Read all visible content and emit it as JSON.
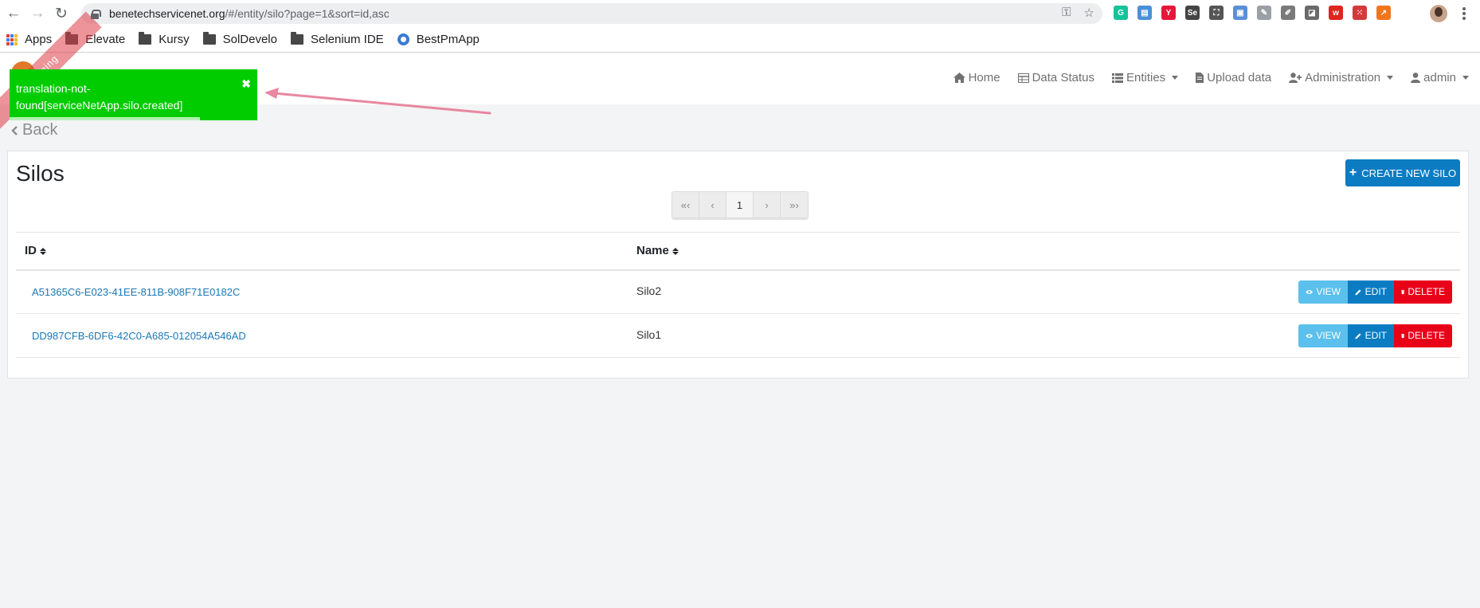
{
  "browser": {
    "url_host": "benetechservicenet.org",
    "url_path": "/#/entity/silo?page=1&sort=id,asc",
    "nav_back": "←",
    "nav_forward": "→",
    "nav_reload": "↻",
    "key_icon": "⚿",
    "star_icon": "☆",
    "bookmarks": [
      {
        "label": "Apps",
        "icon": "apps-grid-icon"
      },
      {
        "label": "Elevate",
        "icon": "folder-icon"
      },
      {
        "label": "Kursy",
        "icon": "folder-icon"
      },
      {
        "label": "SolDevelo",
        "icon": "folder-icon"
      },
      {
        "label": "Selenium IDE",
        "icon": "folder-icon"
      },
      {
        "label": "BestPmApp",
        "icon": "bestpmapp-icon"
      }
    ],
    "extensions": [
      {
        "color": "#15c39a",
        "glyph": "G"
      },
      {
        "color": "#4a90d9",
        "glyph": "▤"
      },
      {
        "color": "#e8173a",
        "glyph": "Y"
      },
      {
        "color": "#444444",
        "glyph": "Se"
      },
      {
        "color": "#555555",
        "glyph": "⛶"
      },
      {
        "color": "#5a8fd6",
        "glyph": "▣"
      },
      {
        "color": "#9aa0a6",
        "glyph": "✎"
      },
      {
        "color": "#7a7a7a",
        "glyph": "✐"
      },
      {
        "color": "#6a6a6a",
        "glyph": "◪"
      },
      {
        "color": "#e0241f",
        "glyph": "w"
      },
      {
        "color": "#d23b3b",
        "glyph": "⁙"
      },
      {
        "color": "#f0761e",
        "glyph": "↗"
      }
    ]
  },
  "navbar": {
    "home": "Home",
    "data_status": "Data Status",
    "entities": "Entities",
    "upload_data": "Upload data",
    "administration": "Administration",
    "account": "admin"
  },
  "ribbon": {
    "text": "Staging"
  },
  "toast": {
    "line1": "translation-not-",
    "line2": "found[serviceNetApp.silo.created]",
    "close": "✖",
    "progress": 0.77
  },
  "back_label": "Back",
  "page": {
    "title": "Silos",
    "create_label": "CREATE NEW SILO",
    "pager": [
      "«‹",
      "‹",
      "1",
      "›",
      "»›"
    ]
  },
  "table": {
    "headers": {
      "id": "ID",
      "name": "Name"
    },
    "rows": [
      {
        "id": "A51365C6-E023-41EE-811B-908F71E0182C",
        "name": "Silo2"
      },
      {
        "id": "DD987CFB-6DF6-42C0-A685-012054A546AD",
        "name": "Silo1"
      }
    ],
    "actions": {
      "view": "VIEW",
      "edit": "EDIT",
      "delete": "DELETE"
    }
  },
  "colors": {
    "toast_bg": "#00cc00",
    "primary": "#0b7cc2",
    "view_btn": "#5bc0eb",
    "delete_btn": "#e80018",
    "annotation_arrow": "#e8879f"
  }
}
